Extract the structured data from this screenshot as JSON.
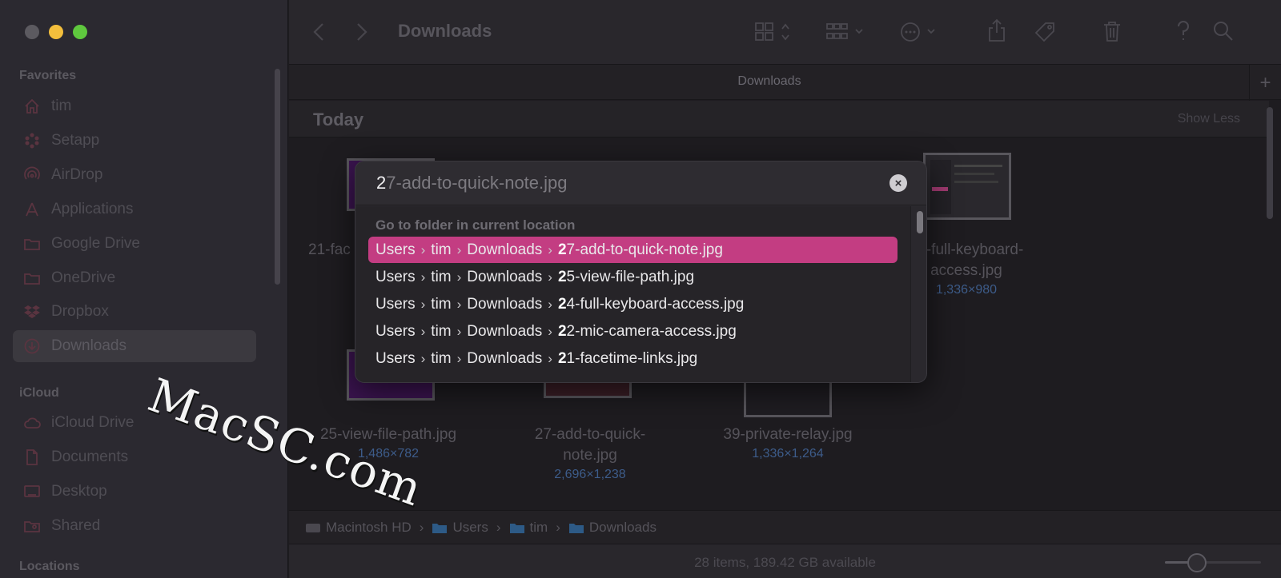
{
  "window": {
    "title": "Downloads",
    "tab_title": "Downloads"
  },
  "sidebar": {
    "favorites_label": "Favorites",
    "favorites": [
      {
        "label": "tim",
        "icon": "home-icon"
      },
      {
        "label": "Setapp",
        "icon": "setapp-icon"
      },
      {
        "label": "AirDrop",
        "icon": "airdrop-icon"
      },
      {
        "label": "Applications",
        "icon": "applications-icon"
      },
      {
        "label": "Google Drive",
        "icon": "folder-icon"
      },
      {
        "label": "OneDrive",
        "icon": "folder-icon"
      },
      {
        "label": "Dropbox",
        "icon": "dropbox-icon"
      },
      {
        "label": "Downloads",
        "icon": "downloads-icon",
        "selected": true
      }
    ],
    "icloud_label": "iCloud",
    "icloud": [
      {
        "label": "iCloud Drive",
        "icon": "cloud-icon"
      },
      {
        "label": "Documents",
        "icon": "document-icon"
      },
      {
        "label": "Desktop",
        "icon": "desktop-icon"
      },
      {
        "label": "Shared",
        "icon": "shared-folder-icon"
      }
    ],
    "locations_label": "Locations"
  },
  "content": {
    "group_title": "Today",
    "show_less": "Show Less",
    "files": [
      {
        "name_line1": "21-fac",
        "name_line2": "",
        "dims": ""
      },
      {
        "name_line1": "24-full-keyboard-",
        "name_line2": "access.jpg",
        "dims": "1,336×980"
      },
      {
        "name_line1": "25-view-file-path.jpg",
        "name_line2": "",
        "dims": "1,486×782"
      },
      {
        "name_line1": "27-add-to-quick-",
        "name_line2": "note.jpg",
        "dims": "2,696×1,238"
      },
      {
        "name_line1": "39-private-relay.jpg",
        "name_line2": "",
        "dims": "1,336×1,264"
      }
    ]
  },
  "goto": {
    "typed": "2",
    "completion": "7-add-to-quick-note.jpg",
    "section_header": "Go to folder in current location",
    "rows": [
      {
        "path": [
          "Users",
          "tim",
          "Downloads"
        ],
        "match": "2",
        "rest": "7-add-to-quick-note.jpg",
        "selected": true
      },
      {
        "path": [
          "Users",
          "tim",
          "Downloads"
        ],
        "match": "2",
        "rest": "5-view-file-path.jpg"
      },
      {
        "path": [
          "Users",
          "tim",
          "Downloads"
        ],
        "match": "2",
        "rest": "4-full-keyboard-access.jpg"
      },
      {
        "path": [
          "Users",
          "tim",
          "Downloads"
        ],
        "match": "2",
        "rest": "2-mic-camera-access.jpg"
      },
      {
        "path": [
          "Users",
          "tim",
          "Downloads"
        ],
        "match": "2",
        "rest": "1-facetime-links.jpg"
      }
    ],
    "accent": "#c33d82"
  },
  "path_bar": [
    "Macintosh HD",
    "Users",
    "tim",
    "Downloads"
  ],
  "status": {
    "text": "28 items, 189.42 GB available"
  },
  "watermark": {
    "text": "MacSC.com",
    "partial": "N"
  }
}
